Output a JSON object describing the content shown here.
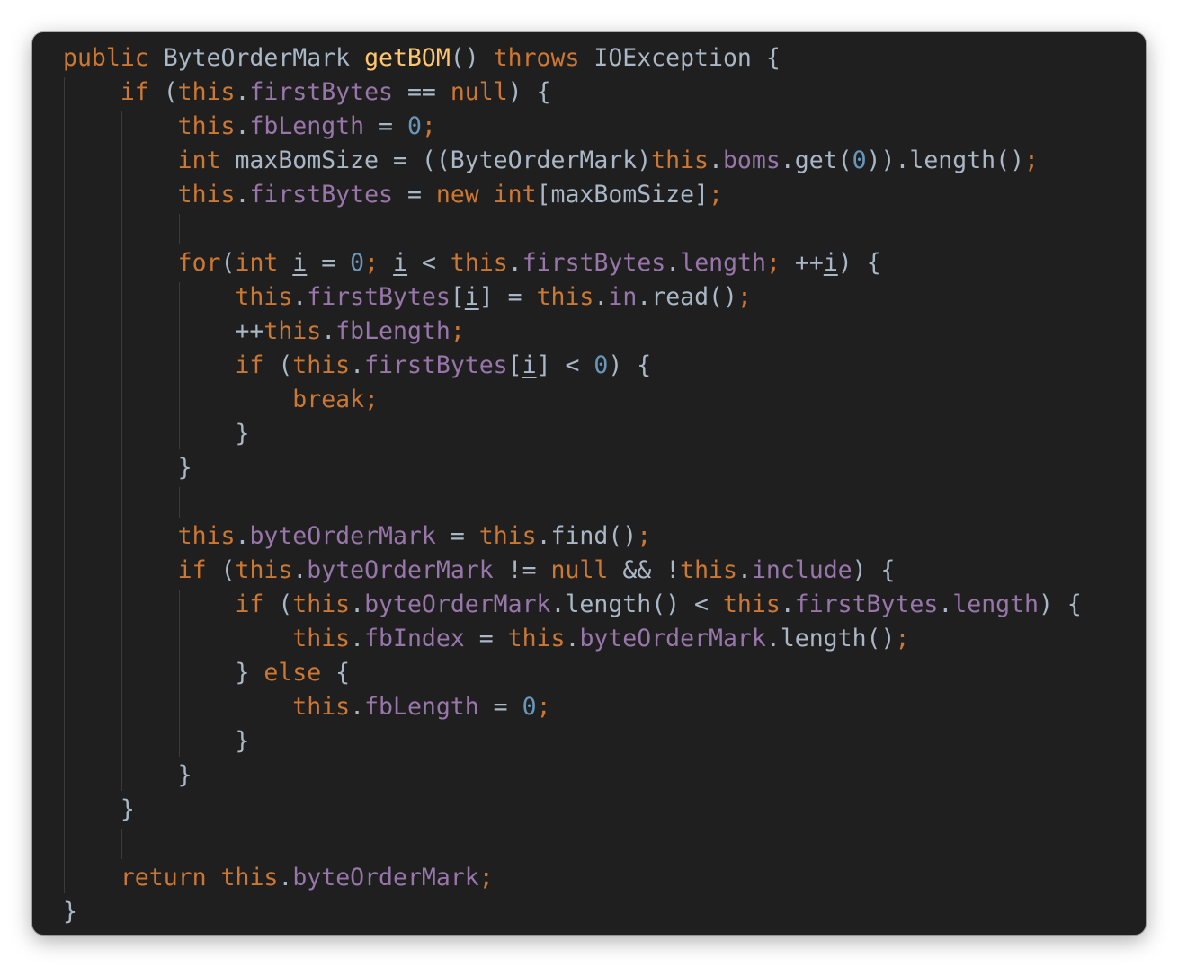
{
  "editor": {
    "language": "java",
    "colors": {
      "background": "#1f1f20",
      "keyword": "#cc7832",
      "field": "#9876aa",
      "number": "#6897bb",
      "function": "#ffc66d",
      "plain": "#a9b7c6",
      "indent_guide": "#393b3d"
    },
    "lines": [
      {
        "indent": 0,
        "tokens": [
          [
            "kw",
            "public"
          ],
          [
            "pl",
            " ByteOrderMark "
          ],
          [
            "fn",
            "getBOM"
          ],
          [
            "pl",
            "() "
          ],
          [
            "kw",
            "throws"
          ],
          [
            "pl",
            " IOException {"
          ]
        ]
      },
      {
        "indent": 1,
        "tokens": [
          [
            "kw",
            "if"
          ],
          [
            "pl",
            " ("
          ],
          [
            "kw",
            "this"
          ],
          [
            "pl",
            "."
          ],
          [
            "fld",
            "firstBytes"
          ],
          [
            "pl",
            " == "
          ],
          [
            "kw",
            "null"
          ],
          [
            "pl",
            ") {"
          ]
        ]
      },
      {
        "indent": 2,
        "tokens": [
          [
            "kw",
            "this"
          ],
          [
            "pl",
            "."
          ],
          [
            "fld",
            "fbLength"
          ],
          [
            "pl",
            " = "
          ],
          [
            "num",
            "0"
          ],
          [
            "kw",
            ";"
          ]
        ]
      },
      {
        "indent": 2,
        "tokens": [
          [
            "kw",
            "int"
          ],
          [
            "pl",
            " maxBomSize = ((ByteOrderMark)"
          ],
          [
            "kw",
            "this"
          ],
          [
            "pl",
            "."
          ],
          [
            "fld",
            "boms"
          ],
          [
            "pl",
            ".get("
          ],
          [
            "num",
            "0"
          ],
          [
            "pl",
            ")).length()"
          ],
          [
            "kw",
            ";"
          ]
        ]
      },
      {
        "indent": 2,
        "tokens": [
          [
            "kw",
            "this"
          ],
          [
            "pl",
            "."
          ],
          [
            "fld",
            "firstBytes"
          ],
          [
            "pl",
            " = "
          ],
          [
            "kw",
            "new int"
          ],
          [
            "pl",
            "[maxBomSize]"
          ],
          [
            "kw",
            ";"
          ]
        ]
      },
      {
        "indent": 0,
        "tokens": []
      },
      {
        "indent": 2,
        "tokens": [
          [
            "kw",
            "for"
          ],
          [
            "pl",
            "("
          ],
          [
            "kw",
            "int"
          ],
          [
            "pl",
            " "
          ],
          [
            "ul",
            "i"
          ],
          [
            "pl",
            " = "
          ],
          [
            "num",
            "0"
          ],
          [
            "kw",
            ";"
          ],
          [
            "pl",
            " "
          ],
          [
            "ul",
            "i"
          ],
          [
            "pl",
            " < "
          ],
          [
            "kw",
            "this"
          ],
          [
            "pl",
            "."
          ],
          [
            "fld",
            "firstBytes"
          ],
          [
            "pl",
            "."
          ],
          [
            "fld",
            "length"
          ],
          [
            "kw",
            ";"
          ],
          [
            "pl",
            " ++"
          ],
          [
            "ul",
            "i"
          ],
          [
            "pl",
            ") {"
          ]
        ]
      },
      {
        "indent": 3,
        "tokens": [
          [
            "kw",
            "this"
          ],
          [
            "pl",
            "."
          ],
          [
            "fld",
            "firstBytes"
          ],
          [
            "pl",
            "["
          ],
          [
            "ul",
            "i"
          ],
          [
            "pl",
            "] = "
          ],
          [
            "kw",
            "this"
          ],
          [
            "pl",
            "."
          ],
          [
            "fld",
            "in"
          ],
          [
            "pl",
            ".read()"
          ],
          [
            "kw",
            ";"
          ]
        ]
      },
      {
        "indent": 3,
        "tokens": [
          [
            "pl",
            "++"
          ],
          [
            "kw",
            "this"
          ],
          [
            "pl",
            "."
          ],
          [
            "fld",
            "fbLength"
          ],
          [
            "kw",
            ";"
          ]
        ]
      },
      {
        "indent": 3,
        "tokens": [
          [
            "kw",
            "if"
          ],
          [
            "pl",
            " ("
          ],
          [
            "kw",
            "this"
          ],
          [
            "pl",
            "."
          ],
          [
            "fld",
            "firstBytes"
          ],
          [
            "pl",
            "["
          ],
          [
            "ul",
            "i"
          ],
          [
            "pl",
            "] < "
          ],
          [
            "num",
            "0"
          ],
          [
            "pl",
            ") {"
          ]
        ]
      },
      {
        "indent": 4,
        "tokens": [
          [
            "kw",
            "break;"
          ]
        ]
      },
      {
        "indent": 3,
        "tokens": [
          [
            "pl",
            "}"
          ]
        ]
      },
      {
        "indent": 2,
        "tokens": [
          [
            "pl",
            "}"
          ]
        ]
      },
      {
        "indent": 0,
        "tokens": []
      },
      {
        "indent": 2,
        "tokens": [
          [
            "kw",
            "this"
          ],
          [
            "pl",
            "."
          ],
          [
            "fld",
            "byteOrderMark"
          ],
          [
            "pl",
            " = "
          ],
          [
            "kw",
            "this"
          ],
          [
            "pl",
            ".find()"
          ],
          [
            "kw",
            ";"
          ]
        ]
      },
      {
        "indent": 2,
        "tokens": [
          [
            "kw",
            "if"
          ],
          [
            "pl",
            " ("
          ],
          [
            "kw",
            "this"
          ],
          [
            "pl",
            "."
          ],
          [
            "fld",
            "byteOrderMark"
          ],
          [
            "pl",
            " != "
          ],
          [
            "kw",
            "null"
          ],
          [
            "pl",
            " && !"
          ],
          [
            "kw",
            "this"
          ],
          [
            "pl",
            "."
          ],
          [
            "fld",
            "include"
          ],
          [
            "pl",
            ") {"
          ]
        ]
      },
      {
        "indent": 3,
        "tokens": [
          [
            "kw",
            "if"
          ],
          [
            "pl",
            " ("
          ],
          [
            "kw",
            "this"
          ],
          [
            "pl",
            "."
          ],
          [
            "fld",
            "byteOrderMark"
          ],
          [
            "pl",
            ".length() < "
          ],
          [
            "kw",
            "this"
          ],
          [
            "pl",
            "."
          ],
          [
            "fld",
            "firstBytes"
          ],
          [
            "pl",
            "."
          ],
          [
            "fld",
            "length"
          ],
          [
            "pl",
            ") {"
          ]
        ]
      },
      {
        "indent": 4,
        "tokens": [
          [
            "kw",
            "this"
          ],
          [
            "pl",
            "."
          ],
          [
            "fld",
            "fbIndex"
          ],
          [
            "pl",
            " = "
          ],
          [
            "kw",
            "this"
          ],
          [
            "pl",
            "."
          ],
          [
            "fld",
            "byteOrderMark"
          ],
          [
            "pl",
            ".length()"
          ],
          [
            "kw",
            ";"
          ]
        ]
      },
      {
        "indent": 3,
        "tokens": [
          [
            "pl",
            "} "
          ],
          [
            "kw",
            "else"
          ],
          [
            "pl",
            " {"
          ]
        ]
      },
      {
        "indent": 4,
        "tokens": [
          [
            "kw",
            "this"
          ],
          [
            "pl",
            "."
          ],
          [
            "fld",
            "fbLength"
          ],
          [
            "pl",
            " = "
          ],
          [
            "num",
            "0"
          ],
          [
            "kw",
            ";"
          ]
        ]
      },
      {
        "indent": 3,
        "tokens": [
          [
            "pl",
            "}"
          ]
        ]
      },
      {
        "indent": 2,
        "tokens": [
          [
            "pl",
            "}"
          ]
        ]
      },
      {
        "indent": 1,
        "tokens": [
          [
            "pl",
            "}"
          ]
        ]
      },
      {
        "indent": 0,
        "tokens": []
      },
      {
        "indent": 1,
        "tokens": [
          [
            "kw",
            "return"
          ],
          [
            "pl",
            " "
          ],
          [
            "kw",
            "this"
          ],
          [
            "pl",
            "."
          ],
          [
            "fld",
            "byteOrderMark"
          ],
          [
            "kw",
            ";"
          ]
        ]
      },
      {
        "indent": 0,
        "tokens": [
          [
            "pl",
            "}"
          ]
        ]
      }
    ]
  }
}
